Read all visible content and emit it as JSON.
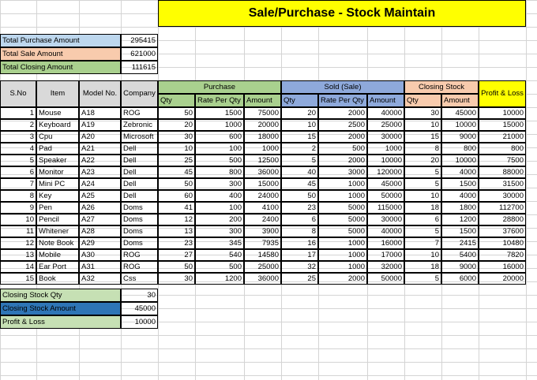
{
  "title": "Sale/Purchase - Stock Maintain",
  "summary_top": [
    {
      "label": "Total Purchase Amount",
      "value": "295415"
    },
    {
      "label": "Total Sale Amount",
      "value": "621000"
    },
    {
      "label": "Total Closing Amount",
      "value": "111615"
    }
  ],
  "headers": {
    "sno": "S.No",
    "item": "Item",
    "model": "Model No.",
    "company": "Company",
    "purchase": "Purchase",
    "sold": "Sold (Sale)",
    "closing": "Closing Stock",
    "profit": "Profit & Loss",
    "qty": "Qty",
    "rate": "Rate Per Qty",
    "amount": "Amount"
  },
  "rows": [
    [
      "1",
      "Mouse",
      "A18",
      "ROG",
      "50",
      "1500",
      "75000",
      "20",
      "2000",
      "40000",
      "30",
      "45000",
      "10000"
    ],
    [
      "2",
      "Keyboard",
      "A19",
      "Zebronic",
      "20",
      "1000",
      "20000",
      "10",
      "2500",
      "25000",
      "10",
      "10000",
      "15000"
    ],
    [
      "3",
      "Cpu",
      "A20",
      "Microsoft",
      "30",
      "600",
      "18000",
      "15",
      "2000",
      "30000",
      "15",
      "9000",
      "21000"
    ],
    [
      "4",
      "Pad",
      "A21",
      "Dell",
      "10",
      "100",
      "1000",
      "2",
      "500",
      "1000",
      "8",
      "800",
      "800"
    ],
    [
      "5",
      "Speaker",
      "A22",
      "Dell",
      "25",
      "500",
      "12500",
      "5",
      "2000",
      "10000",
      "20",
      "10000",
      "7500"
    ],
    [
      "6",
      "Monitor",
      "A23",
      "Dell",
      "45",
      "800",
      "36000",
      "40",
      "3000",
      "120000",
      "5",
      "4000",
      "88000"
    ],
    [
      "7",
      "Mini PC",
      "A24",
      "Dell",
      "50",
      "300",
      "15000",
      "45",
      "1000",
      "45000",
      "5",
      "1500",
      "31500"
    ],
    [
      "8",
      "Key",
      "A25",
      "Dell",
      "60",
      "400",
      "24000",
      "50",
      "1000",
      "50000",
      "10",
      "4000",
      "30000"
    ],
    [
      "9",
      "Pen",
      "A26",
      "Doms",
      "41",
      "100",
      "4100",
      "23",
      "5000",
      "115000",
      "18",
      "1800",
      "112700"
    ],
    [
      "10",
      "Pencil",
      "A27",
      "Doms",
      "12",
      "200",
      "2400",
      "6",
      "5000",
      "30000",
      "6",
      "1200",
      "28800"
    ],
    [
      "11",
      "Whitener",
      "A28",
      "Doms",
      "13",
      "300",
      "3900",
      "8",
      "5000",
      "40000",
      "5",
      "1500",
      "37600"
    ],
    [
      "12",
      "Note Book",
      "A29",
      "Doms",
      "23",
      "345",
      "7935",
      "16",
      "1000",
      "16000",
      "7",
      "2415",
      "10480"
    ],
    [
      "13",
      "Mobile",
      "A30",
      "ROG",
      "27",
      "540",
      "14580",
      "17",
      "1000",
      "17000",
      "10",
      "5400",
      "7820"
    ],
    [
      "14",
      "Ear Port",
      "A31",
      "ROG",
      "50",
      "500",
      "25000",
      "32",
      "1000",
      "32000",
      "18",
      "9000",
      "16000"
    ],
    [
      "15",
      "Book",
      "A32",
      "Css",
      "30",
      "1200",
      "36000",
      "25",
      "2000",
      "50000",
      "5",
      "6000",
      "20000"
    ]
  ],
  "summary_bottom": [
    {
      "label": "Closing Stock Qty",
      "value": "30"
    },
    {
      "label": "Closing Stock Amount",
      "value": "45000"
    },
    {
      "label": "Profit & Loss",
      "value": "10000"
    }
  ],
  "colors": {
    "title_bg": "#ffff00",
    "purchase_bg": "#a9d08e",
    "sold_bg": "#8ea9db",
    "closing_bg": "#f8cbad",
    "profit_bg": "#ffff00",
    "header_bg": "#d9d9d9",
    "closing_amount_bg": "#2e75b6",
    "total_purchase_bg": "#bdd7ee"
  }
}
